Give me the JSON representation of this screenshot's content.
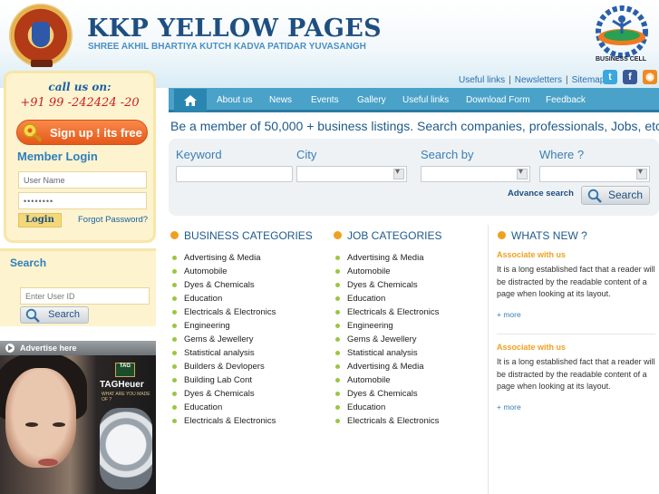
{
  "header": {
    "title": "KKP YELLOW PAGES",
    "subtitle": "SHREE AKHIL BHARTIYA KUTCH KADVA PATIDAR YUVASANGH",
    "seal_text": "SHRI A.B.K.K.P.YUVASANGH",
    "business_cell_label": "BUSINESS CELL",
    "top_links": [
      "Useful links",
      "Newsletters",
      "Sitemap"
    ],
    "social_icons": [
      "twitter-icon",
      "facebook-icon",
      "rss-icon"
    ]
  },
  "left": {
    "callus_heading": "call us on:",
    "callus_number": "+91 99 -242424 -20",
    "signup_label": "Sign up ! its free",
    "member_login_title": "Member Login",
    "username_placeholder": "User Name",
    "password_value": "••••••••",
    "login_label": "Login",
    "forgot_label": "Forgot Password?",
    "search_title": "Search",
    "userid_placeholder": "Enter User ID",
    "search_button": "Search",
    "advertise_label": "Advertise here",
    "ad_tag": "TAG",
    "ad_brand": "TAGHeuer",
    "ad_slogan": "WHAT ARE YOU MADE OF ?"
  },
  "nav": {
    "items": [
      "About us",
      "News",
      "Events",
      "Gallery",
      "Useful links",
      "Download Form",
      "Feedback"
    ]
  },
  "main": {
    "member_line": "Be a member of 50,000 + business listings. Search companies, professionals, Jobs, etc.",
    "search": {
      "labels": [
        "Keyword",
        "City",
        "Search by",
        "Where ?"
      ],
      "advanced_label": "Advance search",
      "button_label": "Search"
    },
    "business_heading": "BUSINESS CATEGORIES",
    "business_items": [
      "Advertising & Media",
      "Automobile",
      "Dyes & Chemicals",
      "Education",
      "Electricals & Electronics",
      "Engineering",
      "Gems & Jewellery",
      "Statistical analysis",
      "Builders & Devlopers",
      "Building Lab Cont",
      "Dyes & Chemicals",
      "Education",
      "Electricals & Electronics"
    ],
    "job_heading": "JOB CATEGORIES",
    "job_items": [
      "Advertising & Media",
      "Automobile",
      "Dyes & Chemicals",
      "Education",
      "Electricals & Electronics",
      "Engineering",
      "Gems & Jewellery",
      "Statistical analysis",
      "Advertising & Media",
      "Automobile",
      "Dyes & Chemicals",
      "Education",
      "Electricals & Electronics"
    ],
    "news_heading": "WHATS NEW ?",
    "news": [
      {
        "title": "Associate with us",
        "body": "It is a long established fact that a reader will be distracted by the readable content of a page when looking at its layout.",
        "more": "+ more"
      },
      {
        "title": "Associate with us",
        "body": "It is a long established fact that a reader will be distracted by the readable content of a page when looking at its layout.",
        "more": "+ more"
      }
    ]
  },
  "colors": {
    "nav_bg": "#4aa2c8",
    "title_blue": "#1f4f80",
    "accent_orange": "#f0a020",
    "panel_cream": "#fdf3cf",
    "bullet_green": "#9ac640",
    "signup_orange": "#e4581a"
  }
}
